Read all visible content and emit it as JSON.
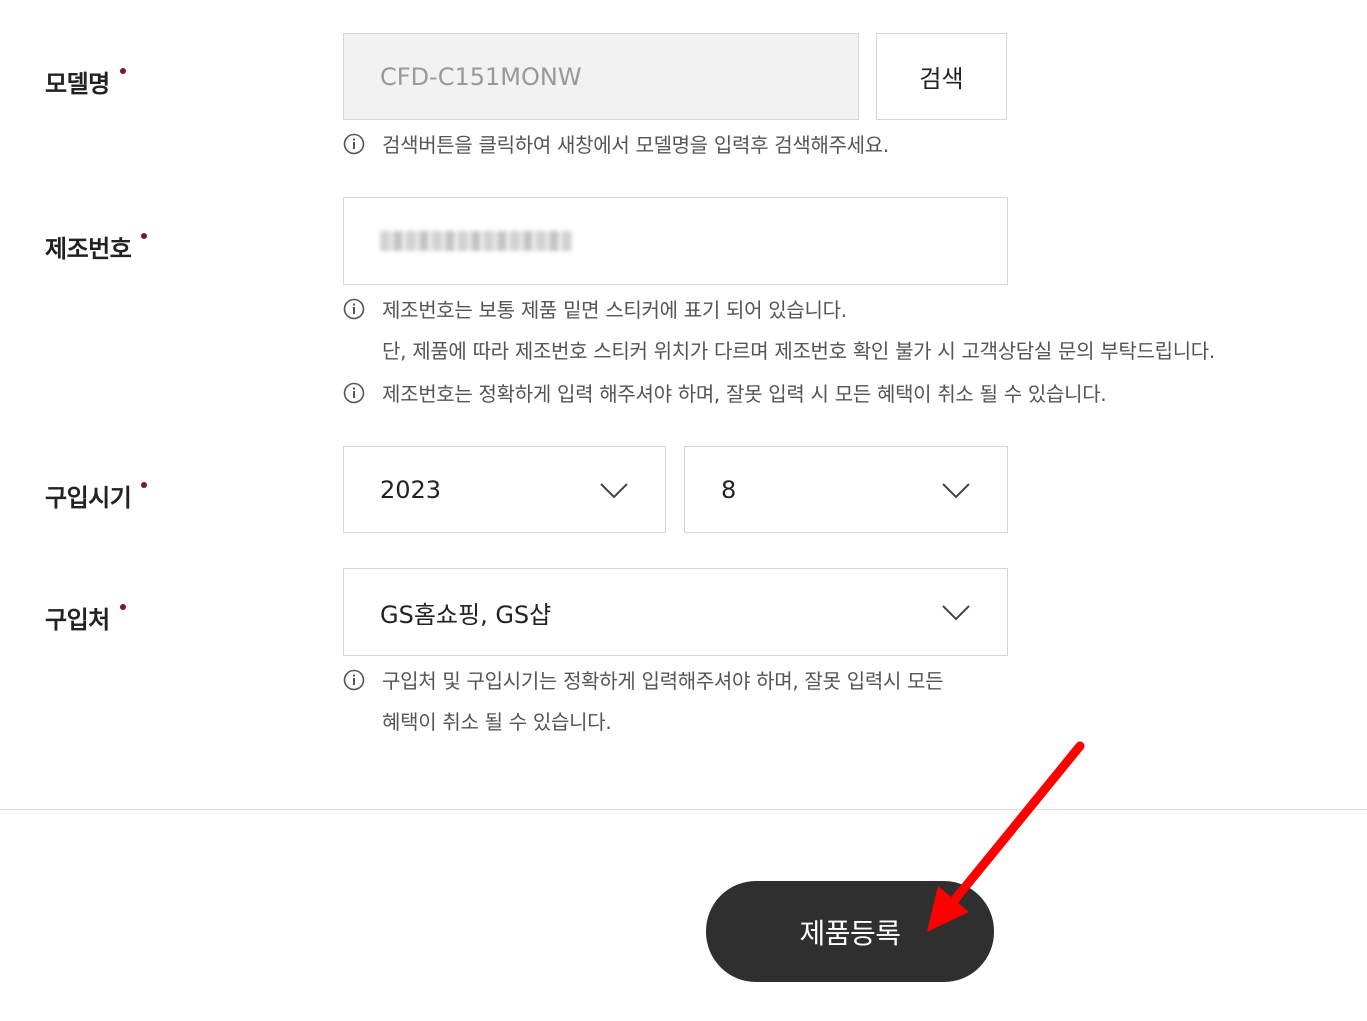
{
  "form": {
    "model": {
      "label": "모델명",
      "value": "CFD-C151MONW",
      "search_button": "검색",
      "note": "검색버튼을 클릭하여 새창에서 모델명을 입력후 검색해주세요."
    },
    "serial": {
      "label": "제조번호",
      "note_1_line_1": "제조번호는 보통 제품 밑면 스티커에 표기 되어 있습니다.",
      "note_1_line_2": "단, 제품에 따라 제조번호 스티커 위치가 다르며 제조번호 확인 불가 시 고객상담실 문의 부탁드립니다.",
      "note_2": "제조번호는 정확하게 입력 해주셔야 하며, 잘못 입력 시 모든 혜택이 취소 될 수 있습니다."
    },
    "purchase_date": {
      "label": "구입시기",
      "year": "2023",
      "month": "8"
    },
    "purchase_place": {
      "label": "구입처",
      "value": "GS홈쇼핑, GS샵",
      "note_line_1": "구입처 및 구입시기는 정확하게 입력해주셔야 하며, 잘못 입력시 모든",
      "note_line_2": "혜택이 취소 될 수 있습니다."
    },
    "submit_label": "제품등록"
  },
  "colors": {
    "required_dot": "#7a1c24",
    "submit_bg": "#2f2f2f",
    "annotation_arrow": "#ff0000"
  }
}
